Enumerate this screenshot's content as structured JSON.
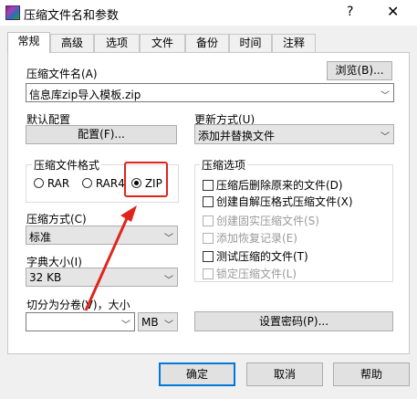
{
  "window": {
    "title": "压缩文件名和参数",
    "help_glyph": "?",
    "close_glyph": "✕"
  },
  "tabs": [
    {
      "label": "常规"
    },
    {
      "label": "高级"
    },
    {
      "label": "选项"
    },
    {
      "label": "文件"
    },
    {
      "label": "备份"
    },
    {
      "label": "时间"
    },
    {
      "label": "注释"
    }
  ],
  "archive_name": {
    "label": "压缩文件名(A)",
    "value": "信息库zip导入模板.zip",
    "browse_button": "浏览(B)..."
  },
  "profile": {
    "label": "默认配置",
    "button": "配置(F)..."
  },
  "update_mode": {
    "label": "更新方式(U)",
    "value": "添加并替换文件"
  },
  "format": {
    "group_title": "压缩文件格式",
    "options": [
      "RAR",
      "RAR4",
      "ZIP"
    ],
    "selected": "ZIP"
  },
  "compression": {
    "label": "压缩方式(C)",
    "value": "标准"
  },
  "dictionary": {
    "label": "字典大小(I)",
    "value": "32 KB"
  },
  "split": {
    "label": "切分为分卷(V)，大小",
    "value": "",
    "unit": "MB"
  },
  "options": {
    "group_title": "压缩选项",
    "items": [
      {
        "label": "压缩后删除原来的文件(D)",
        "enabled": true
      },
      {
        "label": "创建自解压格式压缩文件(X)",
        "enabled": true
      },
      {
        "label": "创建固实压缩文件(S)",
        "enabled": false
      },
      {
        "label": "添加恢复记录(E)",
        "enabled": false
      },
      {
        "label": "测试压缩的文件(T)",
        "enabled": true
      },
      {
        "label": "锁定压缩文件(L)",
        "enabled": false
      }
    ]
  },
  "set_password_button": "设置密码(P)...",
  "footer": {
    "ok": "确定",
    "cancel": "取消",
    "help": "帮助"
  },
  "colors": {
    "accent": "#0078d7",
    "annotation": "#e0241b"
  }
}
